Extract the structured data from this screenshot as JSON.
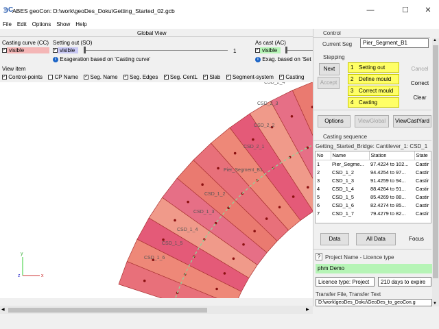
{
  "window": {
    "title": "ABES geoCon: D:\\work\\geoDes_Doku\\Getting_Started_02.gcb",
    "app_icon": "geoCon-app-icon"
  },
  "menu": [
    "File",
    "Edit",
    "Options",
    "Show",
    "Help"
  ],
  "global_view": {
    "header": "Global View",
    "casting_curve": {
      "label": "Casting curve (CC)",
      "checkbox": "visible",
      "color": "#f4b6b6"
    },
    "setting_out": {
      "label": "Setting out (SO)",
      "checkbox": "visible",
      "slider_value": "1",
      "color": "#c8c8f4",
      "note": "Exageration based on 'Casting curve'"
    },
    "as_cast": {
      "label": "As cast (AC)",
      "checkbox": "visible",
      "note": "Exag. based on 'Set",
      "color": "#b6f4b6"
    }
  },
  "view_item": {
    "label": "View item",
    "options": [
      {
        "label": "Control-points",
        "checked": true
      },
      {
        "label": "CP Name",
        "checked": false
      },
      {
        "label": "Seg. Name",
        "checked": true
      },
      {
        "label": "Seg. Edges",
        "checked": true
      },
      {
        "label": "Seg. CentL",
        "checked": true
      },
      {
        "label": "Slab",
        "checked": true
      },
      {
        "label": "Segment-system",
        "checked": true
      },
      {
        "label": "Casting",
        "checked": true
      }
    ]
  },
  "viewport": {
    "segment_labels": [
      "CSD_2_5",
      "CSD_2_4",
      "CSD_2_3",
      "CSD_2_2",
      "CSD_2_1",
      "Pier_Segment_B1",
      "CSD_1_2",
      "CSD_1_3",
      "CSD_1_4",
      "CSD_1_5",
      "CSD_1_6"
    ],
    "axis_y": "y",
    "axis_x": "x",
    "axis_z": "z"
  },
  "control": {
    "header": "Control",
    "current_seg_label": "Current Seg",
    "current_seg_value": "Pier_Segment_B1"
  },
  "stepping": {
    "header": "Stepping",
    "next": "Next",
    "accept": "Accept",
    "steps": [
      {
        "num": "1",
        "label": "Setting out"
      },
      {
        "num": "2",
        "label": "Define mould"
      },
      {
        "num": "3",
        "label": "Correct mould"
      },
      {
        "num": "4",
        "label": "Casting"
      }
    ],
    "cancel": "Cancel",
    "correct": "Correct",
    "clear": "Clear"
  },
  "actions": {
    "options": "Options",
    "view_global": "ViewGlobal",
    "view_cast_yard": "ViewCastYard"
  },
  "casting_sequence": {
    "header": "Casting sequence",
    "bridge": "Getting_Started_Bridge: Cantilever_1: CSD_1",
    "columns": [
      "No",
      "Name",
      "Station",
      "State"
    ],
    "rows": [
      [
        "1",
        "Pier_Segme...",
        "97.4224 to 102...",
        "Castir"
      ],
      [
        "2",
        "CSD_1_2",
        "94.4254 to 97...",
        "Castir"
      ],
      [
        "3",
        "CSD_1_3",
        "91.4259 to 94...",
        "Castir"
      ],
      [
        "4",
        "CSD_1_4",
        "88.4264 to 91...",
        "Castir"
      ],
      [
        "5",
        "CSD_1_5",
        "85.4269 to 88...",
        "Castir"
      ],
      [
        "6",
        "CSD_1_6",
        "82.4274 to 85...",
        "Castir"
      ],
      [
        "7",
        "CSD_1_7",
        "79.4279 to 82...",
        "Castir"
      ]
    ]
  },
  "data_buttons": {
    "data": "Data",
    "all_data": "All Data",
    "focus": "Focus"
  },
  "licence": {
    "help": "?",
    "header": "Project Name - Licence type",
    "project_name": "phm Demo",
    "licence_type": "Licence type: Project",
    "expire": "210 days to expire",
    "transfer_label": "Transfer File, Transfer Text",
    "transfer_path": "D:\\work\\geoDes_Doku\\GeoDes_to_geoCon.g"
  },
  "colors": {
    "visible_cc": "#f4b6b6",
    "visible_so": "#c8c8f4",
    "visible_ac": "#b6f4b6",
    "steps": "#ffff66",
    "project": "#b6f4b6"
  }
}
